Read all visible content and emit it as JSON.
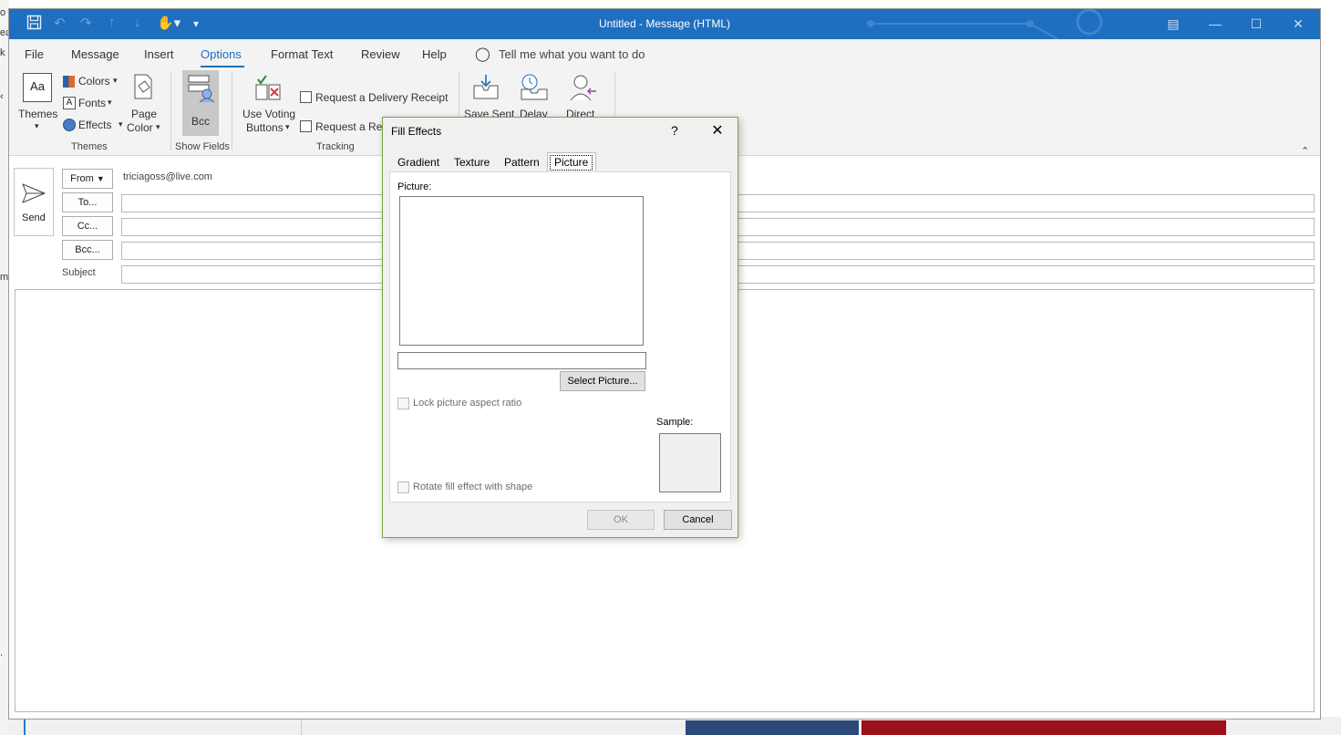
{
  "window": {
    "title": "Untitled  -  Message (HTML)",
    "accent": "#1e6fc0"
  },
  "quick_access": [
    "save-icon",
    "undo-icon",
    "redo-icon",
    "up-icon",
    "down-icon",
    "touch-mode-icon",
    "customize-icon"
  ],
  "menu_tabs": [
    "File",
    "Message",
    "Insert",
    "Options",
    "Format Text",
    "Review",
    "Help"
  ],
  "active_tab": "Options",
  "tell_me": "Tell me what you want to do",
  "ribbon": {
    "themes": {
      "themes_label": "Themes",
      "colors_label": "Colors",
      "fonts_label": "Fonts",
      "effects_label": "Effects",
      "page_color_line1": "Page",
      "page_color_line2": "Color",
      "group_label": "Themes"
    },
    "show_fields": {
      "bcc_label": "Bcc",
      "group_label": "Show Fields"
    },
    "tracking": {
      "voting_line1": "Use Voting",
      "voting_line2": "Buttons",
      "delivery_receipt": "Request a Delivery Receipt",
      "read_receipt": "Request a Read Receipt",
      "group_label": "Tracking"
    },
    "more": {
      "save_sent": "Save Sent",
      "delay": "Delay",
      "direct": "Direct"
    }
  },
  "compose": {
    "send_label": "Send",
    "from_label": "From",
    "from_address": "triciagoss@live.com",
    "to_label": "To...",
    "cc_label": "Cc...",
    "bcc_label": "Bcc...",
    "subject_label": "Subject"
  },
  "dialog": {
    "title": "Fill Effects",
    "help": "?",
    "tabs": [
      "Gradient",
      "Texture",
      "Pattern",
      "Picture"
    ],
    "active_tab": "Picture",
    "picture_label": "Picture:",
    "select_picture": "Select Picture...",
    "lock_aspect": "Lock picture aspect ratio",
    "sample_label": "Sample:",
    "rotate_fill": "Rotate fill effect with shape",
    "ok": "OK",
    "cancel": "Cancel"
  }
}
